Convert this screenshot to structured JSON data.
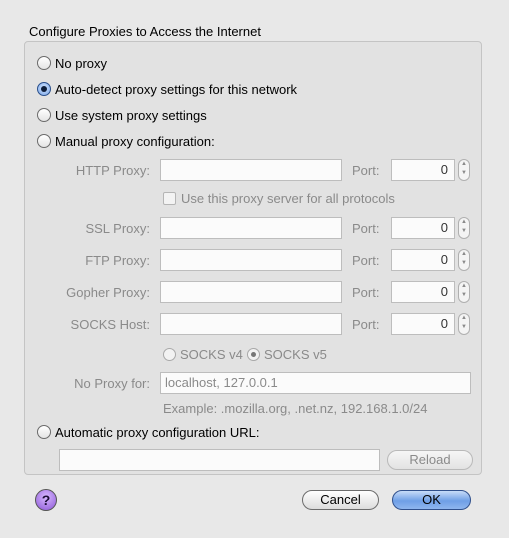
{
  "section_title": "Configure Proxies to Access the Internet",
  "modes": {
    "no_proxy": "No proxy",
    "auto_detect": "Auto-detect proxy settings for this network",
    "system": "Use system proxy settings",
    "manual": "Manual proxy configuration:",
    "auto_url": "Automatic proxy configuration URL:"
  },
  "selected_mode": "auto_detect",
  "manual": {
    "http_label": "HTTP Proxy:",
    "ssl_label": "SSL Proxy:",
    "ftp_label": "FTP Proxy:",
    "gopher_label": "Gopher Proxy:",
    "socks_label": "SOCKS Host:",
    "port_label": "Port:",
    "http_port": "0",
    "ssl_port": "0",
    "ftp_port": "0",
    "gopher_port": "0",
    "socks_port": "0",
    "use_for_all": "Use this proxy server for all protocols",
    "socks_v4": "SOCKS v4",
    "socks_v5": "SOCKS v5",
    "socks_selected": "v5",
    "no_proxy_label": "No Proxy for:",
    "no_proxy_value": "localhost, 127.0.0.1",
    "example": "Example: .mozilla.org, .net.nz, 192.168.1.0/24"
  },
  "buttons": {
    "reload": "Reload",
    "help": "?",
    "cancel": "Cancel",
    "ok": "OK"
  },
  "colors": {
    "accent": "#6f9fe6",
    "help_purple": "#8c57d6"
  }
}
